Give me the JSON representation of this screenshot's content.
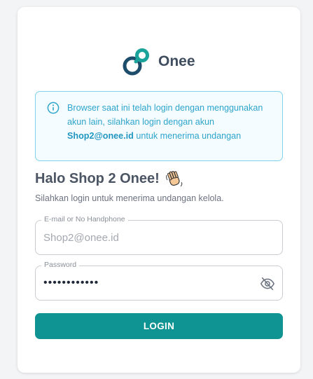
{
  "brand": {
    "name": "Onee",
    "logo_icon": "onee-logo-icon",
    "logo_colors": [
      "#1e4d6b",
      "#1aa39a"
    ]
  },
  "alert": {
    "icon": "info-icon",
    "text_before": "Browser saat ini telah login dengan menggunakan akun lain, silahkan login dengan akun ",
    "email": "Shop2@onee.id",
    "text_after": " untuk menerima undangan",
    "border_color": "#7fd3ea",
    "text_color": "#2ea4cc"
  },
  "greeting": {
    "title": "Halo Shop 2 Onee!",
    "emoji_icon": "waving-hand-icon"
  },
  "subtitle": "Silahkan login untuk menerima undangan kelola.",
  "form": {
    "email": {
      "label": "E-mail or No Handphone",
      "value": "Shop2@onee.id"
    },
    "password": {
      "label": "Password",
      "value": "••••••••••••",
      "toggle_icon": "eye-slash-icon"
    },
    "submit_label": "LOGIN"
  },
  "colors": {
    "primary": "#0f9393",
    "background": "#f3f4f6",
    "card": "#ffffff"
  }
}
